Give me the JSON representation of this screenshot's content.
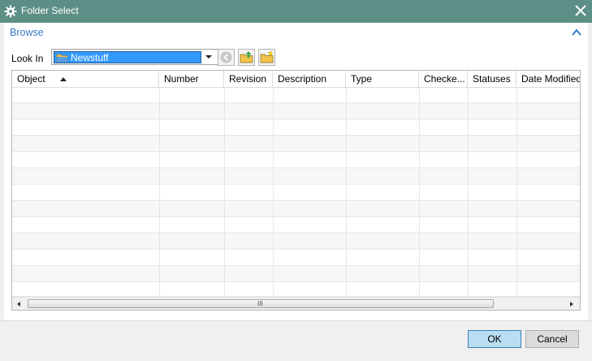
{
  "window": {
    "title": "Folder Select"
  },
  "browse": {
    "title": "Browse"
  },
  "lookin": {
    "label": "Look In",
    "value": "Newstuff"
  },
  "table": {
    "columns": [
      "Object",
      "Number",
      "Revision",
      "Description",
      "Type",
      "Checke...",
      "Statuses",
      "Date Modified"
    ],
    "sorted_column": "Object",
    "sort_direction": "ascending",
    "rows": []
  },
  "scrollbar": {
    "grip": "III"
  },
  "buttons": {
    "ok": "OK",
    "cancel": "Cancel"
  },
  "colors": {
    "titlebar": "#5e8f87",
    "accent": "#3a7bc8",
    "selection": "#3399ff",
    "ok_button": "#b9ddf3"
  },
  "icons": [
    "gear-icon",
    "close-icon",
    "chevron-up-icon",
    "folder-icon",
    "back-icon",
    "folder-up-icon",
    "new-folder-icon"
  ]
}
